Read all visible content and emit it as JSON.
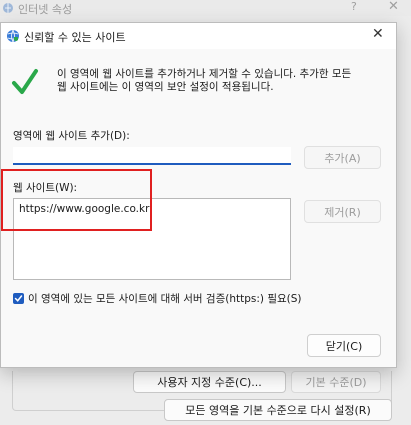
{
  "parent_dialog": {
    "title": "인터넷 속성",
    "help_glyph": "?",
    "close_glyph": "✕",
    "custom_level_button": "사용자 지정 수준(C)...",
    "default_level_button": "기본 수준(D)",
    "reset_all_button": "모든 영역을 기본 수준으로 다시 설정(R)"
  },
  "trusted_sites": {
    "title": "신뢰할 수 있는 사이트",
    "close_glyph": "✕",
    "info_line1": "이 영역에 웹 사이트를 추가하거나 제거할 수 있습니다. 추가한 모든",
    "info_line2": "웹 사이트에는 이 영역의 보안 설정이 적용됩니다.",
    "add_label": "영역에 웹 사이트 추가(D):",
    "add_input_value": "",
    "add_button": "추가(A)",
    "websites_label": "웹 사이트(W):",
    "websites": [
      "https://www.google.co.kr"
    ],
    "remove_button": "제거(R)",
    "https_checkbox_label": "이 영역에 있는 모든 사이트에 대해 서버 검증(https:) 필요(S)",
    "https_checkbox_checked": true,
    "close_button": "닫기(C)"
  },
  "colors": {
    "accent": "#1f5cbf",
    "highlight_box": "#e02020",
    "check_green": "#2aa84a"
  },
  "icons": {
    "parent_window": "shield-globe-icon",
    "modal_window": "shield-globe-icon",
    "info": "green-checkmark-icon"
  }
}
